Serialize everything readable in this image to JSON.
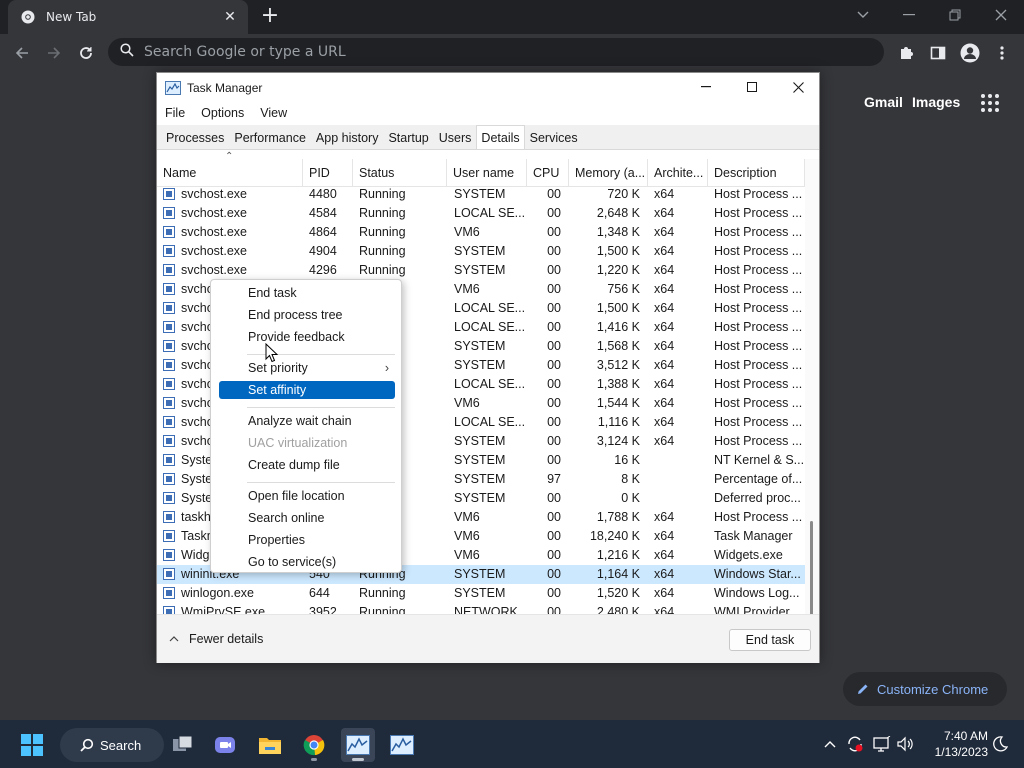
{
  "chrome": {
    "tab_title": "New Tab",
    "new_tab_symbol": "+",
    "omnibox_placeholder": "Search Google or type a URL",
    "ntp_links": [
      "Gmail",
      "Images"
    ],
    "customize_label": "Customize Chrome"
  },
  "taskmgr": {
    "title": "Task Manager",
    "menu": [
      "File",
      "Options",
      "View"
    ],
    "tabs": [
      "Processes",
      "Performance",
      "App history",
      "Startup",
      "Users",
      "Details",
      "Services"
    ],
    "active_tab": "Details",
    "columns": [
      "Name",
      "PID",
      "Status",
      "User name",
      "CPU",
      "Memory (a...",
      "Archite...",
      "Description"
    ],
    "rows": [
      {
        "name": "svchost.exe",
        "pid": "4480",
        "status": "Running",
        "user": "SYSTEM",
        "cpu": "00",
        "mem": "720 K",
        "arch": "x64",
        "desc": "Host Process ..."
      },
      {
        "name": "svchost.exe",
        "pid": "4584",
        "status": "Running",
        "user": "LOCAL SE...",
        "cpu": "00",
        "mem": "2,648 K",
        "arch": "x64",
        "desc": "Host Process ..."
      },
      {
        "name": "svchost.exe",
        "pid": "4864",
        "status": "Running",
        "user": "VM6",
        "cpu": "00",
        "mem": "1,348 K",
        "arch": "x64",
        "desc": "Host Process ..."
      },
      {
        "name": "svchost.exe",
        "pid": "4904",
        "status": "Running",
        "user": "SYSTEM",
        "cpu": "00",
        "mem": "1,500 K",
        "arch": "x64",
        "desc": "Host Process ..."
      },
      {
        "name": "svchost.exe",
        "pid": "4296",
        "status": "Running",
        "user": "SYSTEM",
        "cpu": "00",
        "mem": "1,220 K",
        "arch": "x64",
        "desc": "Host Process ..."
      },
      {
        "name": "svcho",
        "pid": "",
        "status": "",
        "user": "VM6",
        "cpu": "00",
        "mem": "756 K",
        "arch": "x64",
        "desc": "Host Process ..."
      },
      {
        "name": "svcho",
        "pid": "",
        "status": "",
        "user": "LOCAL SE...",
        "cpu": "00",
        "mem": "1,500 K",
        "arch": "x64",
        "desc": "Host Process ..."
      },
      {
        "name": "svcho",
        "pid": "",
        "status": "",
        "user": "LOCAL SE...",
        "cpu": "00",
        "mem": "1,416 K",
        "arch": "x64",
        "desc": "Host Process ..."
      },
      {
        "name": "svcho",
        "pid": "",
        "status": "",
        "user": "SYSTEM",
        "cpu": "00",
        "mem": "1,568 K",
        "arch": "x64",
        "desc": "Host Process ..."
      },
      {
        "name": "svcho",
        "pid": "",
        "status": "",
        "user": "SYSTEM",
        "cpu": "00",
        "mem": "3,512 K",
        "arch": "x64",
        "desc": "Host Process ..."
      },
      {
        "name": "svcho",
        "pid": "",
        "status": "",
        "user": "LOCAL SE...",
        "cpu": "00",
        "mem": "1,388 K",
        "arch": "x64",
        "desc": "Host Process ..."
      },
      {
        "name": "svcho",
        "pid": "",
        "status": "",
        "user": "VM6",
        "cpu": "00",
        "mem": "1,544 K",
        "arch": "x64",
        "desc": "Host Process ..."
      },
      {
        "name": "svcho",
        "pid": "",
        "status": "",
        "user": "LOCAL SE...",
        "cpu": "00",
        "mem": "1,116 K",
        "arch": "x64",
        "desc": "Host Process ..."
      },
      {
        "name": "svcho",
        "pid": "",
        "status": "",
        "user": "SYSTEM",
        "cpu": "00",
        "mem": "3,124 K",
        "arch": "x64",
        "desc": "Host Process ..."
      },
      {
        "name": "Syster",
        "pid": "",
        "status": "",
        "user": "SYSTEM",
        "cpu": "00",
        "mem": "16 K",
        "arch": "",
        "desc": "NT Kernel & S..."
      },
      {
        "name": "Syster",
        "pid": "",
        "status": "",
        "user": "SYSTEM",
        "cpu": "97",
        "mem": "8 K",
        "arch": "",
        "desc": "Percentage of..."
      },
      {
        "name": "Syster",
        "pid": "",
        "status": "",
        "user": "SYSTEM",
        "cpu": "00",
        "mem": "0 K",
        "arch": "",
        "desc": "Deferred proc..."
      },
      {
        "name": "taskh",
        "pid": "",
        "status": "",
        "user": "VM6",
        "cpu": "00",
        "mem": "1,788 K",
        "arch": "x64",
        "desc": "Host Process ..."
      },
      {
        "name": "Taskm",
        "pid": "",
        "status": "",
        "user": "VM6",
        "cpu": "00",
        "mem": "18,240 K",
        "arch": "x64",
        "desc": "Task Manager"
      },
      {
        "name": "Widge",
        "pid": "",
        "status": "",
        "user": "VM6",
        "cpu": "00",
        "mem": "1,216 K",
        "arch": "x64",
        "desc": "Widgets.exe"
      },
      {
        "name": "wininit.exe",
        "pid": "540",
        "status": "Running",
        "user": "SYSTEM",
        "cpu": "00",
        "mem": "1,164 K",
        "arch": "x64",
        "desc": "Windows Star..."
      },
      {
        "name": "winlogon.exe",
        "pid": "644",
        "status": "Running",
        "user": "SYSTEM",
        "cpu": "00",
        "mem": "1,520 K",
        "arch": "x64",
        "desc": "Windows Log..."
      },
      {
        "name": "WmiPrvSE.exe",
        "pid": "3952",
        "status": "Running",
        "user": "NETWORK ...",
        "cpu": "00",
        "mem": "2,480 K",
        "arch": "x64",
        "desc": "WMI Provider..."
      }
    ],
    "selected_row": 20,
    "fewer_details": "Fewer details",
    "end_task": "End task"
  },
  "context_menu": {
    "items": [
      {
        "label": "End task",
        "state": "normal"
      },
      {
        "label": "End process tree",
        "state": "normal"
      },
      {
        "label": "Provide feedback",
        "state": "normal"
      },
      {
        "label": "---"
      },
      {
        "label": "Set priority",
        "state": "normal",
        "submenu": true
      },
      {
        "label": "Set affinity",
        "state": "highlighted"
      },
      {
        "label": "---"
      },
      {
        "label": "Analyze wait chain",
        "state": "normal"
      },
      {
        "label": "UAC virtualization",
        "state": "disabled"
      },
      {
        "label": "Create dump file",
        "state": "normal"
      },
      {
        "label": "---"
      },
      {
        "label": "Open file location",
        "state": "normal"
      },
      {
        "label": "Search online",
        "state": "normal"
      },
      {
        "label": "Properties",
        "state": "normal"
      },
      {
        "label": "Go to service(s)",
        "state": "normal"
      }
    ],
    "highlight_color": "#0067c0"
  },
  "taskbar": {
    "search_label": "Search",
    "time": "7:40 AM",
    "date": "1/13/2023"
  }
}
